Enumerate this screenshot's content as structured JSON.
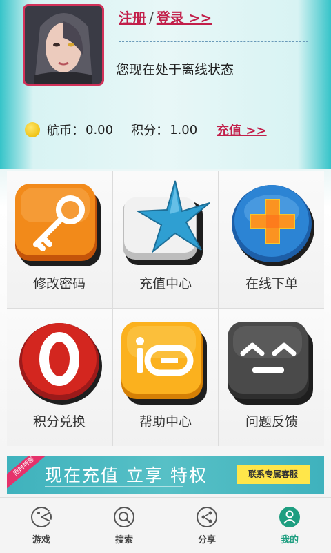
{
  "header": {
    "register_label": "注册",
    "separator": "/",
    "login_label": "登录 >>",
    "status_text": "您现在处于离线状态",
    "coin_label": "航币：",
    "coin_value": "0.00",
    "points_label": "积分：",
    "points_value": "1.00",
    "recharge_link": "充值 >>"
  },
  "grid": {
    "items": [
      {
        "label": "修改密码",
        "icon": "key-icon"
      },
      {
        "label": "充值中心",
        "icon": "star-icon"
      },
      {
        "label": "在线下单",
        "icon": "plus-icon"
      },
      {
        "label": "积分兑换",
        "icon": "opera-icon"
      },
      {
        "label": "帮助中心",
        "icon": "io-icon"
      },
      {
        "label": "问题反馈",
        "icon": "face-icon"
      }
    ]
  },
  "banner": {
    "ribbon": "限时特惠",
    "promo_text": "现在充值 立享 特权",
    "service_button": "联系专属客服"
  },
  "tabbar": {
    "items": [
      {
        "label": "游戏",
        "icon": "pacman-icon"
      },
      {
        "label": "搜索",
        "icon": "search-icon"
      },
      {
        "label": "分享",
        "icon": "share-icon"
      },
      {
        "label": "我的",
        "icon": "user-icon",
        "active": true
      }
    ]
  },
  "colors": {
    "accent": "#c21f4a",
    "tab_active": "#1e9e80",
    "banner": "#3fb2bd"
  }
}
